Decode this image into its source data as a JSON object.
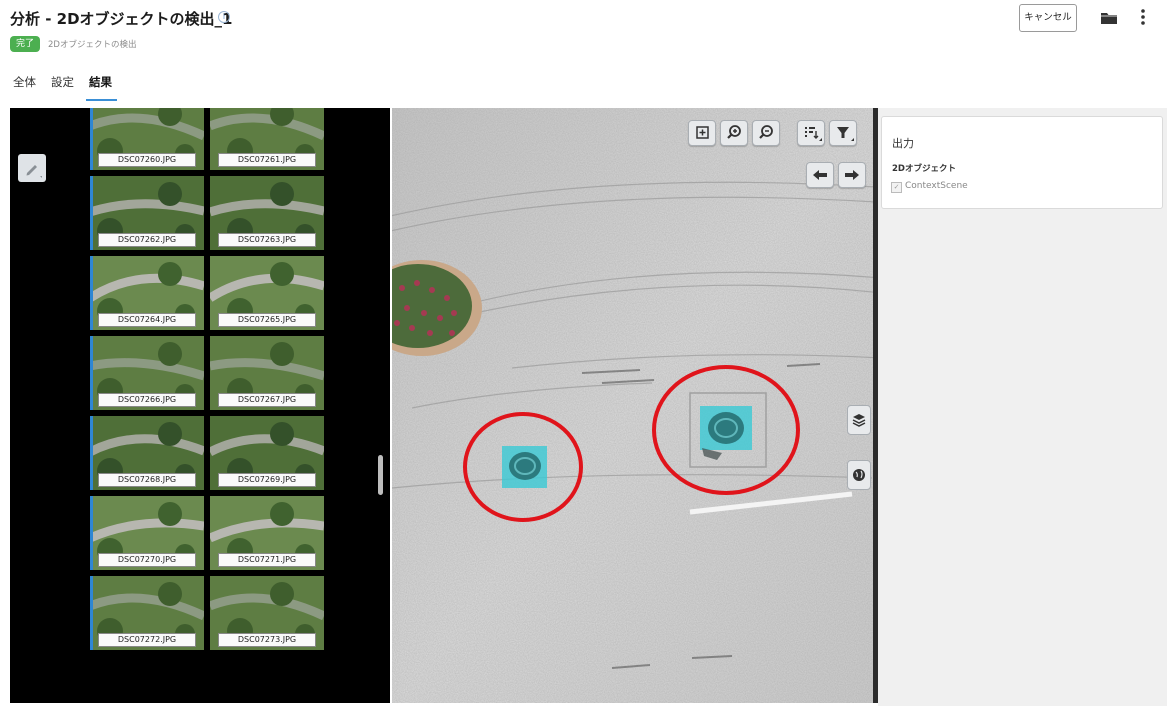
{
  "header": {
    "title": "分析 - 2Dオブジェクトの検出_1",
    "info_glyph": "i",
    "status": "完了",
    "subtitle": "2Dオブジェクトの検出",
    "cancel_label": "キャンセル"
  },
  "tabs": [
    {
      "label": "全体",
      "active": false
    },
    {
      "label": "設定",
      "active": false
    },
    {
      "label": "結果",
      "active": true
    }
  ],
  "thumbnails": [
    {
      "label": "DSC07260.JPG",
      "selected": true
    },
    {
      "label": "DSC07261.JPG",
      "selected": false
    },
    {
      "label": "DSC07262.JPG",
      "selected": true
    },
    {
      "label": "DSC07263.JPG",
      "selected": false
    },
    {
      "label": "DSC07264.JPG",
      "selected": true
    },
    {
      "label": "DSC07265.JPG",
      "selected": false
    },
    {
      "label": "DSC07266.JPG",
      "selected": true
    },
    {
      "label": "DSC07267.JPG",
      "selected": false
    },
    {
      "label": "DSC07268.JPG",
      "selected": true
    },
    {
      "label": "DSC07269.JPG",
      "selected": false
    },
    {
      "label": "DSC07270.JPG",
      "selected": true
    },
    {
      "label": "DSC07271.JPG",
      "selected": false
    },
    {
      "label": "DSC07272.JPG",
      "selected": true
    },
    {
      "label": "DSC07273.JPG",
      "selected": false
    }
  ],
  "output": {
    "title": "出力",
    "section": "2Dオブジェクト",
    "item_label": "ContextScene",
    "item_checked": true
  },
  "colors": {
    "accent": "#3a8fd6",
    "status_green": "#4caf50",
    "detection_circle": "#e0141b",
    "detection_box": "#39c9d4"
  }
}
